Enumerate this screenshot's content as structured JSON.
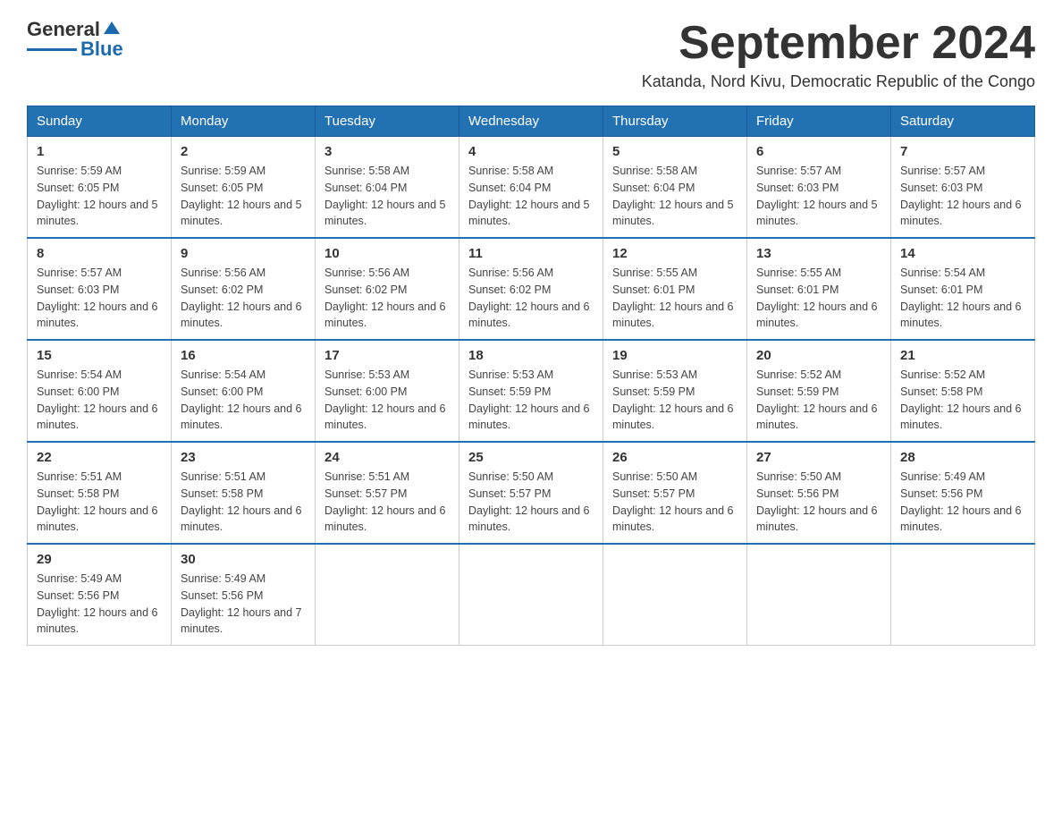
{
  "header": {
    "logo_text1": "General",
    "logo_text2": "Blue",
    "month_title": "September 2024",
    "subtitle": "Katanda, Nord Kivu, Democratic Republic of the Congo"
  },
  "days_of_week": [
    "Sunday",
    "Monday",
    "Tuesday",
    "Wednesday",
    "Thursday",
    "Friday",
    "Saturday"
  ],
  "weeks": [
    [
      {
        "day": "1",
        "sunrise": "5:59 AM",
        "sunset": "6:05 PM",
        "daylight": "12 hours and 5 minutes."
      },
      {
        "day": "2",
        "sunrise": "5:59 AM",
        "sunset": "6:05 PM",
        "daylight": "12 hours and 5 minutes."
      },
      {
        "day": "3",
        "sunrise": "5:58 AM",
        "sunset": "6:04 PM",
        "daylight": "12 hours and 5 minutes."
      },
      {
        "day": "4",
        "sunrise": "5:58 AM",
        "sunset": "6:04 PM",
        "daylight": "12 hours and 5 minutes."
      },
      {
        "day": "5",
        "sunrise": "5:58 AM",
        "sunset": "6:04 PM",
        "daylight": "12 hours and 5 minutes."
      },
      {
        "day": "6",
        "sunrise": "5:57 AM",
        "sunset": "6:03 PM",
        "daylight": "12 hours and 5 minutes."
      },
      {
        "day": "7",
        "sunrise": "5:57 AM",
        "sunset": "6:03 PM",
        "daylight": "12 hours and 6 minutes."
      }
    ],
    [
      {
        "day": "8",
        "sunrise": "5:57 AM",
        "sunset": "6:03 PM",
        "daylight": "12 hours and 6 minutes."
      },
      {
        "day": "9",
        "sunrise": "5:56 AM",
        "sunset": "6:02 PM",
        "daylight": "12 hours and 6 minutes."
      },
      {
        "day": "10",
        "sunrise": "5:56 AM",
        "sunset": "6:02 PM",
        "daylight": "12 hours and 6 minutes."
      },
      {
        "day": "11",
        "sunrise": "5:56 AM",
        "sunset": "6:02 PM",
        "daylight": "12 hours and 6 minutes."
      },
      {
        "day": "12",
        "sunrise": "5:55 AM",
        "sunset": "6:01 PM",
        "daylight": "12 hours and 6 minutes."
      },
      {
        "day": "13",
        "sunrise": "5:55 AM",
        "sunset": "6:01 PM",
        "daylight": "12 hours and 6 minutes."
      },
      {
        "day": "14",
        "sunrise": "5:54 AM",
        "sunset": "6:01 PM",
        "daylight": "12 hours and 6 minutes."
      }
    ],
    [
      {
        "day": "15",
        "sunrise": "5:54 AM",
        "sunset": "6:00 PM",
        "daylight": "12 hours and 6 minutes."
      },
      {
        "day": "16",
        "sunrise": "5:54 AM",
        "sunset": "6:00 PM",
        "daylight": "12 hours and 6 minutes."
      },
      {
        "day": "17",
        "sunrise": "5:53 AM",
        "sunset": "6:00 PM",
        "daylight": "12 hours and 6 minutes."
      },
      {
        "day": "18",
        "sunrise": "5:53 AM",
        "sunset": "5:59 PM",
        "daylight": "12 hours and 6 minutes."
      },
      {
        "day": "19",
        "sunrise": "5:53 AM",
        "sunset": "5:59 PM",
        "daylight": "12 hours and 6 minutes."
      },
      {
        "day": "20",
        "sunrise": "5:52 AM",
        "sunset": "5:59 PM",
        "daylight": "12 hours and 6 minutes."
      },
      {
        "day": "21",
        "sunrise": "5:52 AM",
        "sunset": "5:58 PM",
        "daylight": "12 hours and 6 minutes."
      }
    ],
    [
      {
        "day": "22",
        "sunrise": "5:51 AM",
        "sunset": "5:58 PM",
        "daylight": "12 hours and 6 minutes."
      },
      {
        "day": "23",
        "sunrise": "5:51 AM",
        "sunset": "5:58 PM",
        "daylight": "12 hours and 6 minutes."
      },
      {
        "day": "24",
        "sunrise": "5:51 AM",
        "sunset": "5:57 PM",
        "daylight": "12 hours and 6 minutes."
      },
      {
        "day": "25",
        "sunrise": "5:50 AM",
        "sunset": "5:57 PM",
        "daylight": "12 hours and 6 minutes."
      },
      {
        "day": "26",
        "sunrise": "5:50 AM",
        "sunset": "5:57 PM",
        "daylight": "12 hours and 6 minutes."
      },
      {
        "day": "27",
        "sunrise": "5:50 AM",
        "sunset": "5:56 PM",
        "daylight": "12 hours and 6 minutes."
      },
      {
        "day": "28",
        "sunrise": "5:49 AM",
        "sunset": "5:56 PM",
        "daylight": "12 hours and 6 minutes."
      }
    ],
    [
      {
        "day": "29",
        "sunrise": "5:49 AM",
        "sunset": "5:56 PM",
        "daylight": "12 hours and 6 minutes."
      },
      {
        "day": "30",
        "sunrise": "5:49 AM",
        "sunset": "5:56 PM",
        "daylight": "12 hours and 7 minutes."
      },
      null,
      null,
      null,
      null,
      null
    ]
  ],
  "labels": {
    "sunrise_prefix": "Sunrise: ",
    "sunset_prefix": "Sunset: ",
    "daylight_prefix": "Daylight: "
  }
}
